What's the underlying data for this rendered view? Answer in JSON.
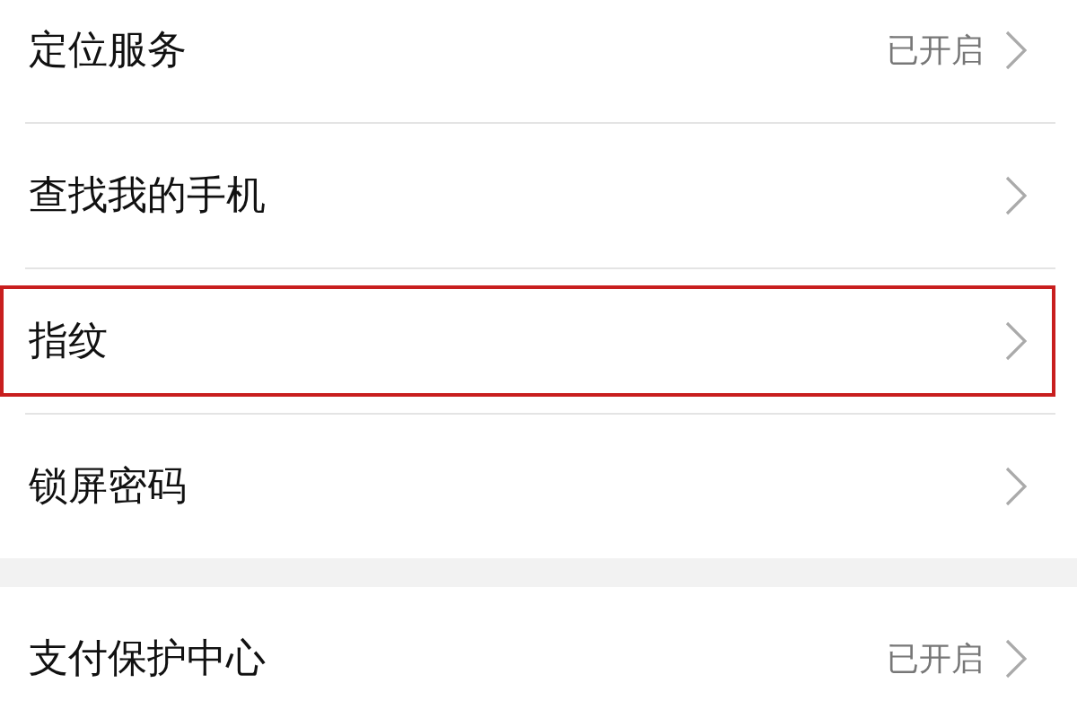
{
  "sections": [
    {
      "items": [
        {
          "label": "定位服务",
          "status": "已开启",
          "highlighted": false
        },
        {
          "label": "查找我的手机",
          "highlighted": false
        },
        {
          "label": "指纹",
          "highlighted": true
        },
        {
          "label": "锁屏密码",
          "highlighted": false
        }
      ]
    },
    {
      "items": [
        {
          "label": "支付保护中心",
          "status": "已开启",
          "highlighted": false
        }
      ]
    }
  ]
}
